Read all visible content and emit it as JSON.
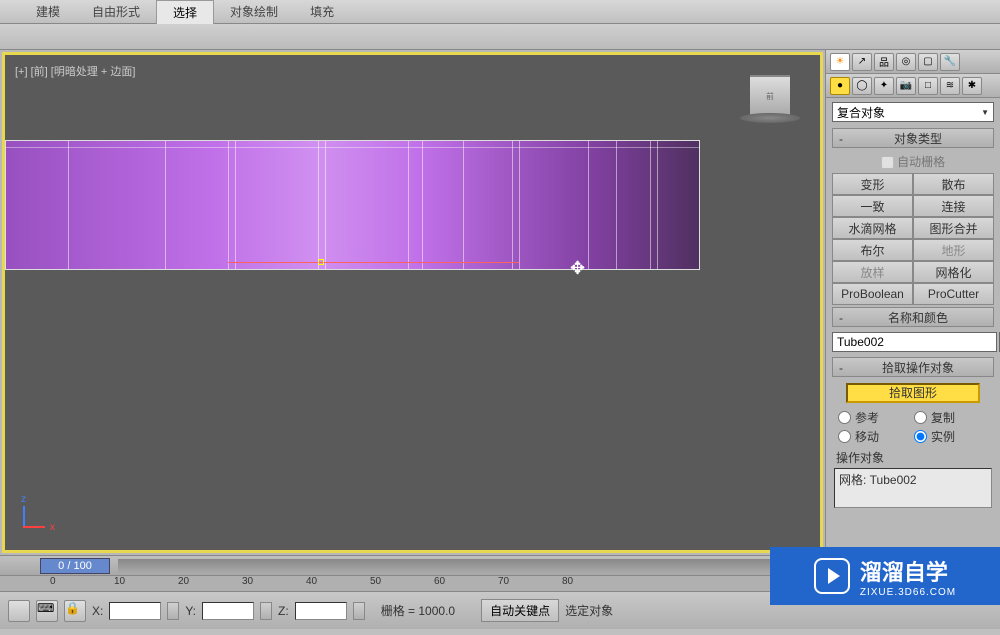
{
  "topTabs": {
    "modeling": "建模",
    "freeform": "自由形式",
    "selection": "选择",
    "objectPaint": "对象绘制",
    "fill": "填充"
  },
  "viewport": {
    "label": "[+] [前] [明暗处理 + 边面]",
    "cubeFace": "前"
  },
  "panel": {
    "dropdown": "复合对象",
    "objectTypeHeader": "对象类型",
    "autoGrid": "自动栅格",
    "buttons": {
      "morph": "变形",
      "scatter": "散布",
      "conform": "一致",
      "connect": "连接",
      "blobmesh": "水滴网格",
      "shapemerge": "图形合并",
      "boolean": "布尔",
      "terrain": "地形",
      "loft": "放样",
      "mesher": "网格化",
      "proboolean": "ProBoolean",
      "procutter": "ProCutter"
    },
    "nameColorHeader": "名称和颜色",
    "objectName": "Tube002",
    "pickOperandHeader": "拾取操作对象",
    "pickShape": "拾取图形",
    "radios": {
      "reference": "参考",
      "copy": "复制",
      "move": "移动",
      "instance": "实例"
    },
    "operandLabel": "操作对象",
    "operandItem": "网格: Tube002"
  },
  "timeline": {
    "frame": "0 / 100",
    "marks": [
      "0",
      "10",
      "20",
      "30",
      "40",
      "50",
      "60",
      "70",
      "80"
    ]
  },
  "bottomBar": {
    "xLabel": "X:",
    "yLabel": "Y:",
    "zLabel": "Z:",
    "gridLabel": "栅格 = 1000.0",
    "autoKey": "自动关键点",
    "selectedObj": "选定对象"
  },
  "watermark": {
    "main": "溜溜自学",
    "sub": "ZIXUE.3D66.COM"
  }
}
